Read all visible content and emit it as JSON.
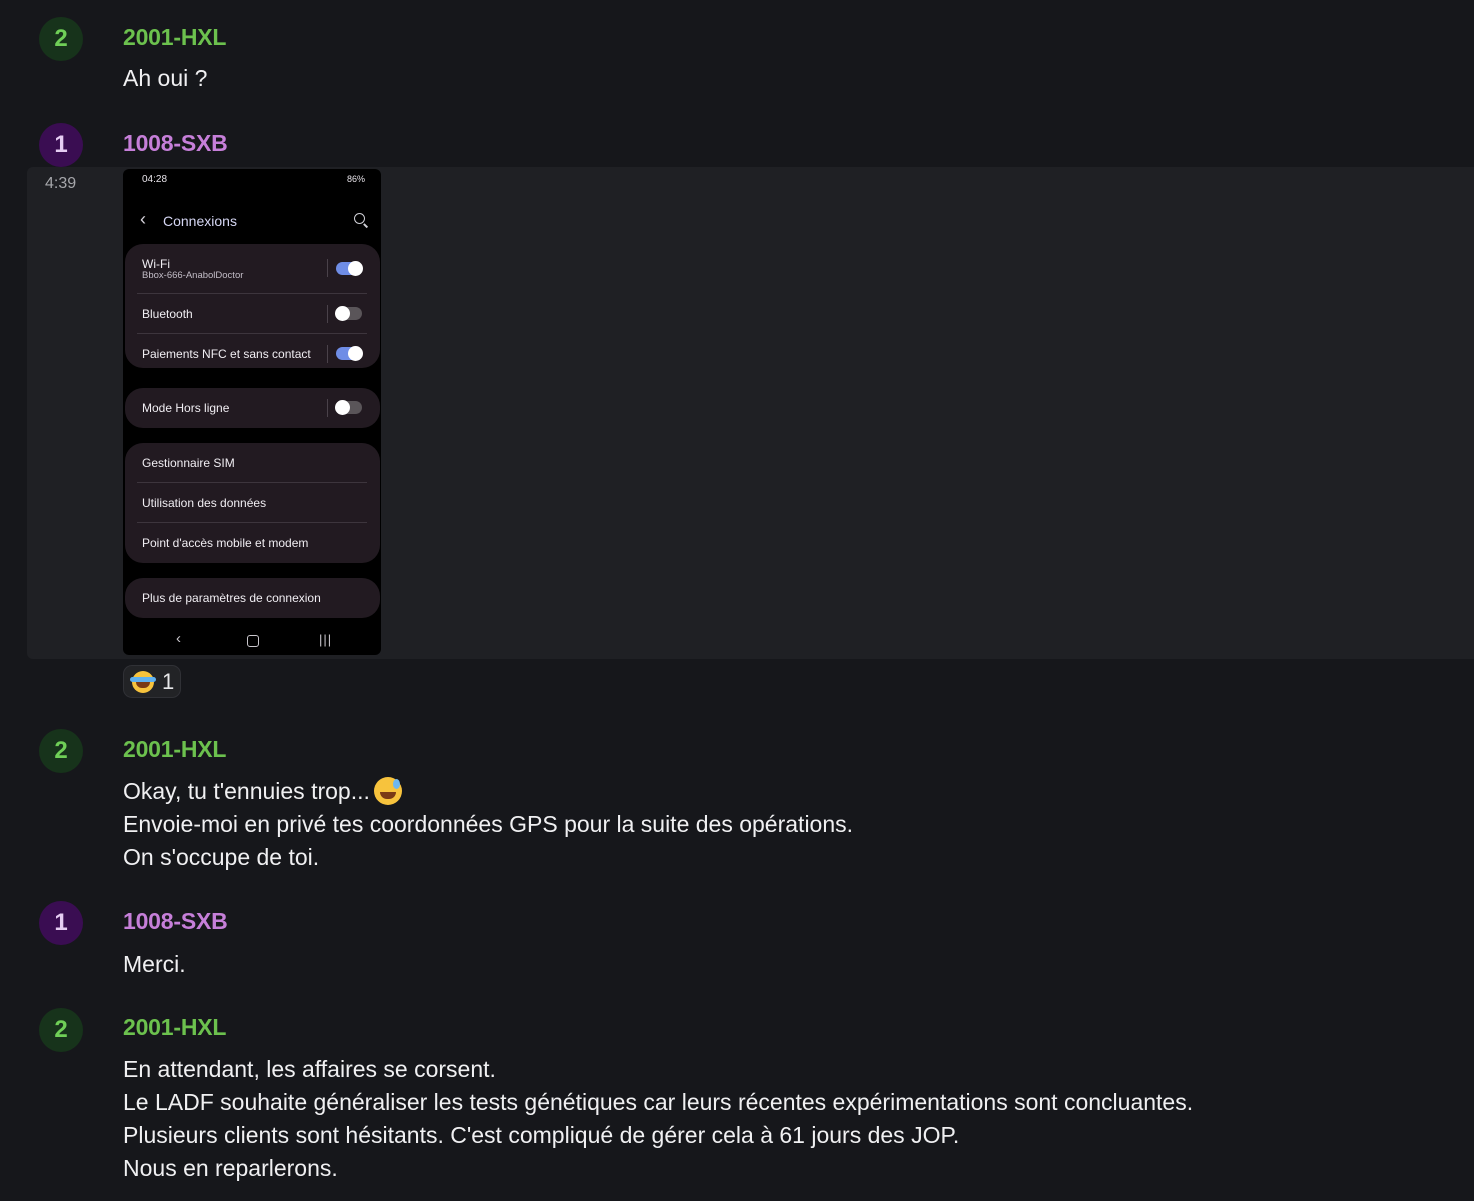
{
  "messages": [
    {
      "avatar": "2",
      "author": "2001-HXL",
      "lines": [
        "Ah oui ?"
      ]
    },
    {
      "avatar": "1",
      "author": "1008-SXB",
      "time": "4:39",
      "screenshot": {
        "status_time": "04:28",
        "status_right": "86%",
        "title": "Connexions",
        "rows": [
          {
            "label": "Wi-Fi",
            "sub": "Bbox-666-AnabolDoctor",
            "toggle": true
          },
          {
            "label": "Bluetooth",
            "toggle": false
          },
          {
            "label": "Paiements NFC et sans contact",
            "toggle": true
          },
          {
            "label": "Mode Hors ligne",
            "toggle": false
          },
          {
            "label": "Gestionnaire SIM"
          },
          {
            "label": "Utilisation des données"
          },
          {
            "label": "Point d'accès mobile et modem"
          },
          {
            "label": "Plus de paramètres de connexion"
          }
        ]
      },
      "reaction": {
        "icon": "face-with-tears-of-joy-emoji",
        "count": "1"
      }
    },
    {
      "avatar": "2",
      "author": "2001-HXL",
      "lines": [
        "Okay, tu t'ennuies trop...",
        "Envoie-moi en privé tes coordonnées GPS pour la suite des opérations.",
        "On s'occupe de toi."
      ],
      "emoji": "grinning-sweat-emoji"
    },
    {
      "avatar": "1",
      "author": "1008-SXB",
      "lines": [
        "Merci."
      ]
    },
    {
      "avatar": "2",
      "author": "2001-HXL",
      "lines": [
        "En attendant, les affaires se corsent.",
        "Le LADF souhaite généraliser les tests génétiques car leurs récentes expérimentations sont concluantes.",
        "Plusieurs clients sont hésitants. C'est compliqué de gérer cela à 61 jours des JOP.",
        "Nous en reparlerons."
      ]
    }
  ],
  "colors": {
    "background": "#16171b",
    "green_author": "#6cc14e",
    "purple_author": "#c67fd9",
    "toggle_on": "#6f8de6"
  }
}
